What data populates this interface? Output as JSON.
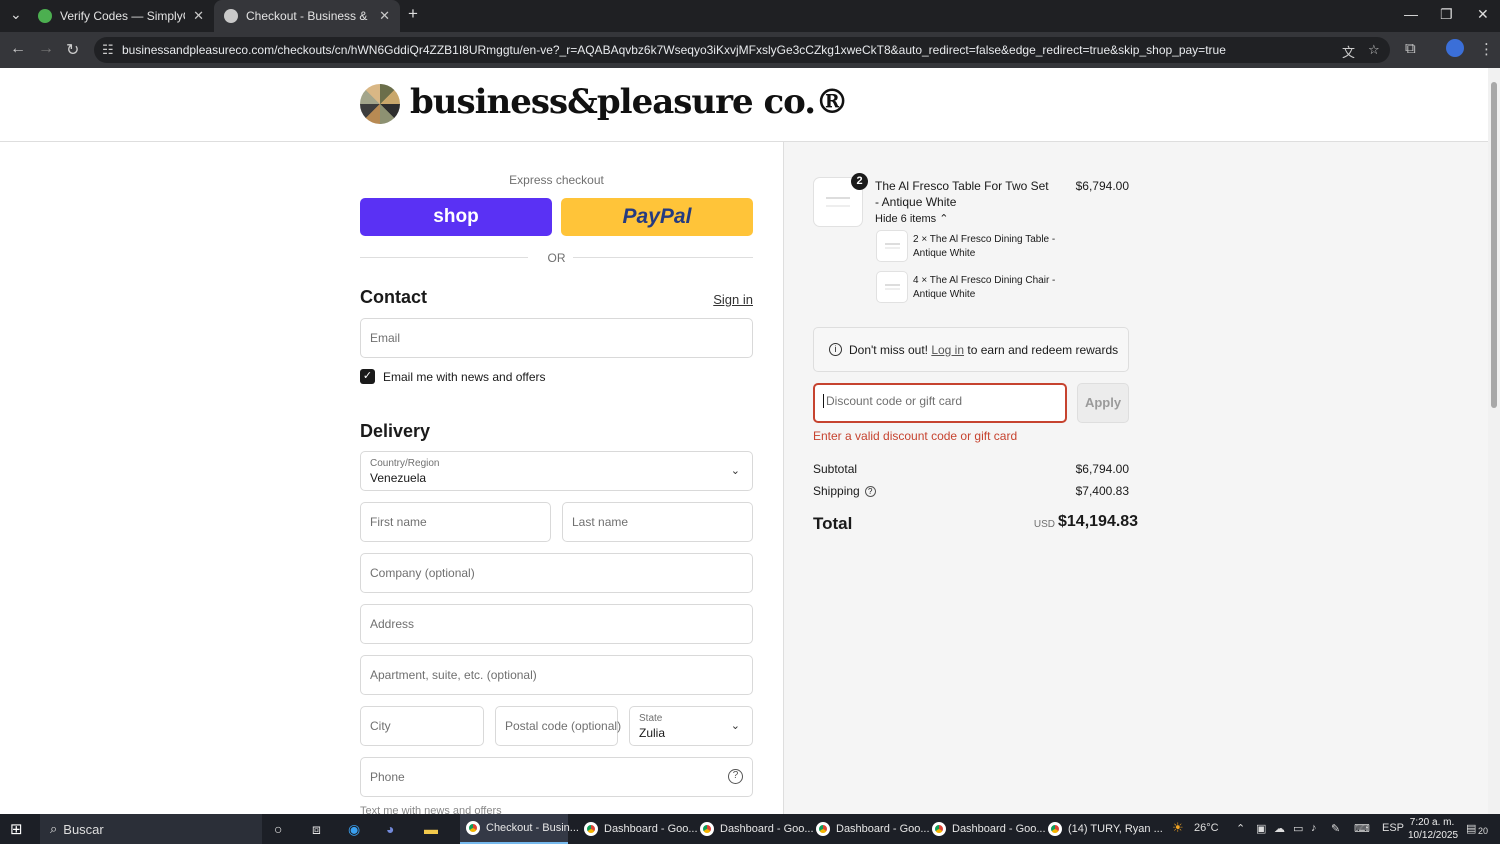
{
  "browser": {
    "tabs": [
      {
        "title": "Verify Codes — SimplyCodes",
        "active": false
      },
      {
        "title": "Checkout - Business & Pleasure",
        "active": true
      }
    ],
    "url": "businessandpleasureco.com/checkouts/cn/hWN6GddiQr4ZZB1I8URmggtu/en-ve?_r=AQABAqvbz6k7Wseqyo3iKxvjMFxslyGe3cCZkg1xweCkT8&auto_redirect=false&edge_redirect=true&skip_shop_pay=true"
  },
  "header": {
    "logo_text": "business&pleasure co.®"
  },
  "express": {
    "title": "Express checkout",
    "shop_label": "shop",
    "paypal_label": "PayPal",
    "or_label": "OR"
  },
  "contact": {
    "heading": "Contact",
    "signin_label": "Sign in",
    "email_placeholder": "Email",
    "newsletter_label": "Email me with news and offers"
  },
  "delivery": {
    "heading": "Delivery",
    "country_label": "Country/Region",
    "country_value": "Venezuela",
    "first_name_placeholder": "First name",
    "last_name_placeholder": "Last name",
    "company_placeholder": "Company (optional)",
    "address_placeholder": "Address",
    "apartment_placeholder": "Apartment, suite, etc. (optional)",
    "city_placeholder": "City",
    "postal_placeholder": "Postal code (optional)",
    "state_label": "State",
    "state_value": "Zulia",
    "phone_placeholder": "Phone",
    "next_line_partial": "Text me with news and offers"
  },
  "summary": {
    "product": {
      "quantity": "2",
      "name": "The Al Fresco Table For Two Set - Antique White",
      "price": "$6,794.00",
      "hide_label": "Hide 6 items ⌃"
    },
    "sub_items": [
      {
        "name": "2 × The Al Fresco Dining Table - Antique White"
      },
      {
        "name": "4 × The Al Fresco Dining Chair - Antique White"
      }
    ],
    "rewards": {
      "prefix": "Don't miss out!",
      "link": "Log in",
      "suffix": "to earn and redeem rewards"
    },
    "discount_placeholder": "Discount code or gift card",
    "apply_label": "Apply",
    "error": "Enter a valid discount code or gift card",
    "subtotal_label": "Subtotal",
    "subtotal_value": "$6,794.00",
    "shipping_label": "Shipping",
    "shipping_value": "$7,400.83",
    "total_label": "Total",
    "total_currency": "USD",
    "total_value": "$14,194.83"
  },
  "taskbar": {
    "search_label": "Buscar",
    "items": [
      {
        "label": "Checkout - Busin..."
      },
      {
        "label": "Dashboard - Goo..."
      },
      {
        "label": "Dashboard - Goo..."
      },
      {
        "label": "Dashboard - Goo..."
      },
      {
        "label": "Dashboard - Goo..."
      },
      {
        "label": "(14) TURY, Ryan ..."
      }
    ],
    "weather": "26°C",
    "language": "ESP",
    "time": "7:20 a. m.",
    "date": "10/12/2025",
    "notifications": "20"
  },
  "colors": {
    "shop": "#5a31f4",
    "paypal": "#ffc439",
    "error": "#c6432f"
  }
}
